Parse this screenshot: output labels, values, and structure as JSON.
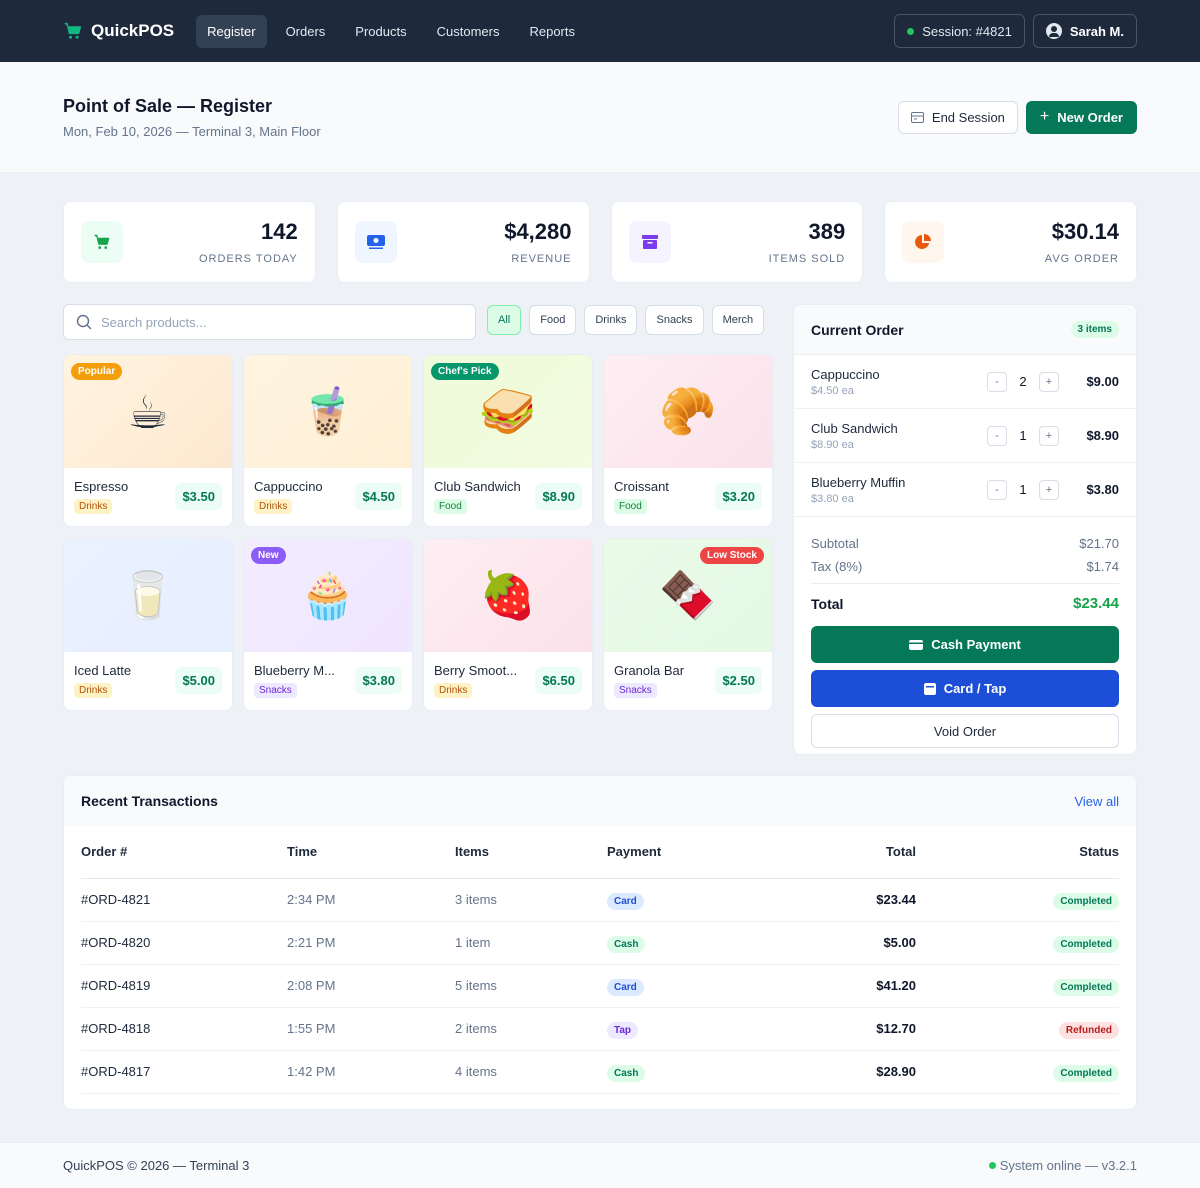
{
  "app": {
    "brand": "QuickPOS"
  },
  "nav": {
    "items": [
      "Register",
      "Orders",
      "Products",
      "Customers",
      "Reports"
    ],
    "active": "Register",
    "session": "Session: #4821",
    "user": "Sarah M."
  },
  "header": {
    "title": "Point of Sale — Register",
    "subtitle": "Mon, Feb 10, 2026 — Terminal 3, Main Floor",
    "end_session": "End Session",
    "new_order": "New Order"
  },
  "stats": [
    {
      "value": "142",
      "label": "ORDERS TODAY",
      "icon": "cart-icon",
      "color": "#16a34a",
      "bg": "#ecfdf5"
    },
    {
      "value": "$4,280",
      "label": "REVENUE",
      "icon": "cash-icon",
      "color": "#2563eb",
      "bg": "#eff6ff"
    },
    {
      "value": "389",
      "label": "ITEMS SOLD",
      "icon": "box-icon",
      "color": "#7c3aed",
      "bg": "#f5f3ff"
    },
    {
      "value": "$30.14",
      "label": "AVG ORDER",
      "icon": "pie-icon",
      "color": "#ea580c",
      "bg": "#fff7ed"
    }
  ],
  "search": {
    "placeholder": "Search products..."
  },
  "filters": {
    "items": [
      "All",
      "Food",
      "Drinks",
      "Snacks",
      "Merch"
    ],
    "active": "All"
  },
  "products": [
    {
      "name": "Espresso",
      "category": "Drinks",
      "price": "$3.50",
      "emoji": "☕",
      "badge": "Popular",
      "badge_color": "#f59e0b",
      "badge_side": "left",
      "bg": "linear-gradient(135deg,#fff4e0,#fde8d0)"
    },
    {
      "name": "Cappuccino",
      "category": "Drinks",
      "price": "$4.50",
      "emoji": "🧋",
      "badge": "",
      "bg": "linear-gradient(135deg,#fff4e0,#fdf0d6)"
    },
    {
      "name": "Club Sandwich",
      "category": "Food",
      "price": "$8.90",
      "emoji": "🥪",
      "badge": "Chef's Pick",
      "badge_color": "#059669",
      "badge_side": "left",
      "bg": "linear-gradient(135deg,#eefbd9,#f3fbe0)"
    },
    {
      "name": "Croissant",
      "category": "Food",
      "price": "$3.20",
      "emoji": "🥐",
      "badge": "",
      "bg": "linear-gradient(135deg,#fdeef2,#fbe2ea)"
    },
    {
      "name": "Iced Latte",
      "category": "Drinks",
      "price": "$5.00",
      "emoji": "🥛",
      "badge": "",
      "bg": "linear-gradient(135deg,#eaf2ff,#e6efff)"
    },
    {
      "name": "Blueberry M...",
      "category": "Snacks",
      "price": "$3.80",
      "emoji": "🧁",
      "badge": "New",
      "badge_color": "#8b5cf6",
      "badge_side": "left",
      "bg": "linear-gradient(135deg,#f3ecff,#efe6ff)"
    },
    {
      "name": "Berry Smoot...",
      "category": "Drinks",
      "price": "$6.50",
      "emoji": "🍓",
      "badge": "",
      "bg": "linear-gradient(135deg,#fdeef2,#fbe2ea)"
    },
    {
      "name": "Granola Bar",
      "category": "Snacks",
      "price": "$2.50",
      "emoji": "🍫",
      "badge": "Low Stock",
      "badge_color": "#ef4444",
      "badge_side": "right",
      "bg": "linear-gradient(135deg,#eafbe8,#e4f8e4)"
    }
  ],
  "category_colors": {
    "Drinks": {
      "bg": "#fef3c7",
      "fg": "#b45309"
    },
    "Food": {
      "bg": "#dcfce7",
      "fg": "#15803d"
    },
    "Snacks": {
      "bg": "#ede9fe",
      "fg": "#6d28d9"
    }
  },
  "order": {
    "title": "Current Order",
    "count": "3 items",
    "lines": [
      {
        "name": "Cappuccino",
        "each": "$4.50 ea",
        "qty": "2",
        "total": "$9.00"
      },
      {
        "name": "Club Sandwich",
        "each": "$8.90 ea",
        "qty": "1",
        "total": "$8.90"
      },
      {
        "name": "Blueberry Muffin",
        "each": "$3.80 ea",
        "qty": "1",
        "total": "$3.80"
      }
    ],
    "subtotal_label": "Subtotal",
    "subtotal": "$21.70",
    "tax_label": "Tax (8%)",
    "tax": "$1.74",
    "total_label": "Total",
    "total": "$23.44",
    "cash_label": "Cash Payment",
    "card_label": "Card / Tap",
    "void_label": "Void Order"
  },
  "transactions": {
    "title": "Recent Transactions",
    "view_all": "View all",
    "columns": [
      "Order #",
      "Time",
      "Items",
      "Payment",
      "Total",
      "Status"
    ],
    "rows": [
      {
        "id": "#ORD-4821",
        "time": "2:34 PM",
        "items": "3 items",
        "payment": "Card",
        "total": "$23.44",
        "status": "Completed"
      },
      {
        "id": "#ORD-4820",
        "time": "2:21 PM",
        "items": "1 item",
        "payment": "Cash",
        "total": "$5.00",
        "status": "Completed"
      },
      {
        "id": "#ORD-4819",
        "time": "2:08 PM",
        "items": "5 items",
        "payment": "Card",
        "total": "$41.20",
        "status": "Completed"
      },
      {
        "id": "#ORD-4818",
        "time": "1:55 PM",
        "items": "2 items",
        "payment": "Tap",
        "total": "$12.70",
        "status": "Refunded"
      },
      {
        "id": "#ORD-4817",
        "time": "1:42 PM",
        "items": "4 items",
        "payment": "Cash",
        "total": "$28.90",
        "status": "Completed"
      }
    ]
  },
  "footer": {
    "left": "QuickPOS © 2026 — Terminal 3",
    "right": "System online — v3.2.1"
  }
}
